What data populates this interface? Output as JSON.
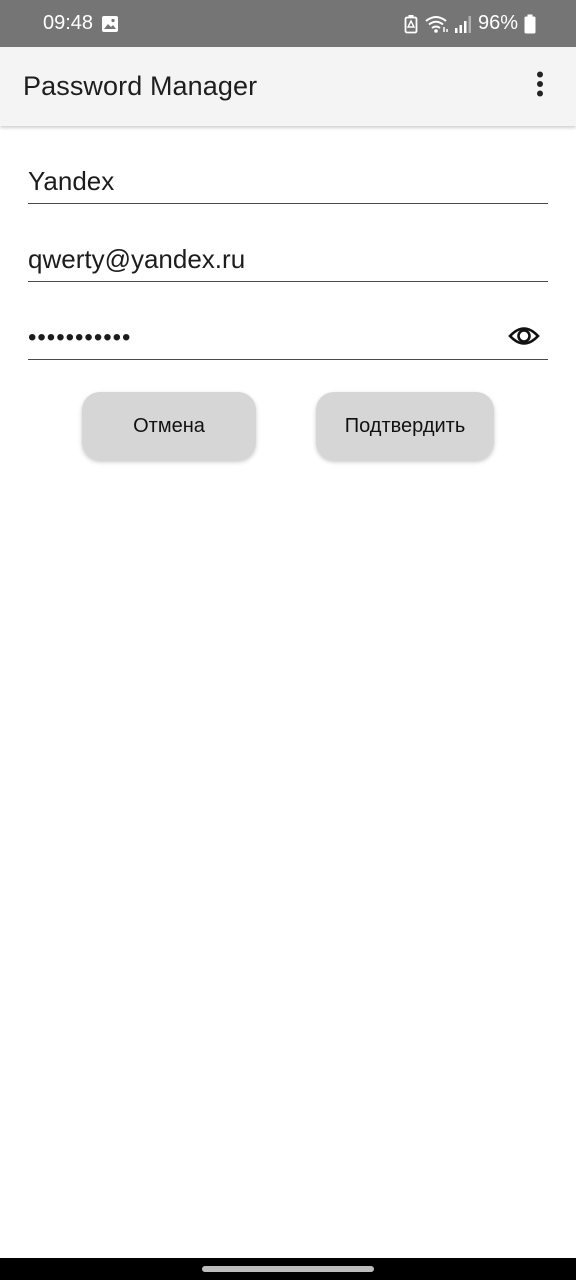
{
  "status_bar": {
    "time": "09:48",
    "battery": "96%",
    "icons": [
      "gallery-icon",
      "battery-saver-icon",
      "wifi-icon",
      "signal-icon",
      "battery-icon"
    ]
  },
  "app_bar": {
    "title": "Password Manager",
    "menu_icon": "more-vert-icon"
  },
  "form": {
    "site": {
      "value": "Yandex"
    },
    "login": {
      "value": "qwerty@yandex.ru"
    },
    "password": {
      "value": "•••••••••••",
      "toggle_icon": "eye-icon"
    }
  },
  "actions": {
    "cancel_label": "Отмена",
    "confirm_label": "Подтвердить"
  },
  "colors": {
    "status_bar": "#757575",
    "app_bar": "#f4f4f4",
    "button": "#d6d6d6"
  }
}
